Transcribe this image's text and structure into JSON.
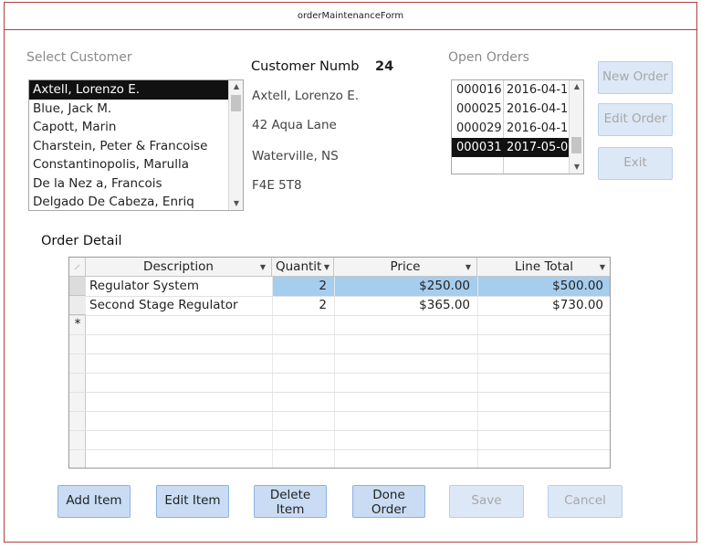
{
  "window": {
    "title": "orderMaintenanceForm"
  },
  "customer_select": {
    "label": "Select Customer",
    "items": [
      "Axtell, Lorenzo E.",
      "Blue, Jack M.",
      "Capott, Marin",
      "Charstein, Peter & Francoise",
      "Constantinopolis, Marulla",
      "De la Nez a, Francois",
      "Delgado De Cabeza, Enriq"
    ],
    "selected_index": 0
  },
  "customer": {
    "number_label": "Customer Numb",
    "number_value": "24",
    "name": "Axtell, Lorenzo E.",
    "address": "42 Aqua Lane",
    "city": "Waterville, NS",
    "postal": "F4E 5T8"
  },
  "open_orders": {
    "label": "Open Orders",
    "rows": [
      {
        "id": "000016",
        "date": "2016-04-1"
      },
      {
        "id": "000025",
        "date": "2016-04-1"
      },
      {
        "id": "000029",
        "date": "2016-04-1"
      },
      {
        "id": "000031",
        "date": "2017-05-0"
      }
    ],
    "selected_index": 3
  },
  "side_buttons": {
    "new_order": "New Order",
    "edit_order": "Edit Order",
    "exit": "Exit"
  },
  "order_detail": {
    "label": "Order Detail",
    "columns": [
      "Description",
      "Quantit",
      "Price",
      "Line Total"
    ],
    "rows": [
      {
        "description": "Regulator System",
        "quantity": "2",
        "price": "$250.00",
        "line_total": "$500.00"
      },
      {
        "description": "Second Stage Regulator",
        "quantity": "2",
        "price": "$365.00",
        "line_total": "$730.00"
      }
    ],
    "new_row_marker": "*"
  },
  "bottom_buttons": {
    "add_item": "Add Item",
    "edit_item": "Edit Item",
    "delete_item": "Delete Item",
    "done_order": "Done Order",
    "save": "Save",
    "cancel": "Cancel"
  },
  "colors": {
    "window_border": "#b0413e",
    "button_fill": "#c9dcf3",
    "selection": "#111111",
    "cell_highlight": "#a5cdee"
  }
}
